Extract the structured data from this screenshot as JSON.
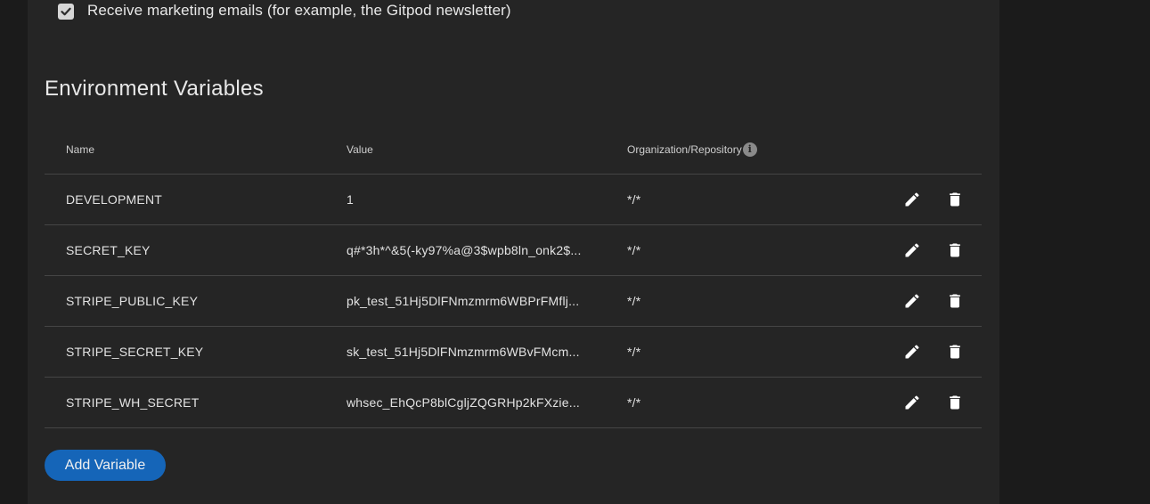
{
  "preferences": {
    "marketing_checkbox_checked": true,
    "marketing_label": "Receive marketing emails (for example, the Gitpod newsletter)"
  },
  "env_section": {
    "title": "Environment Variables",
    "columns": {
      "name": "Name",
      "value": "Value",
      "scope": "Organization/Repository"
    },
    "info_icon": "info-icon",
    "rows": [
      {
        "name": "DEVELOPMENT",
        "value": "1",
        "scope": "*/*"
      },
      {
        "name": "SECRET_KEY",
        "value": "q#*3h*^&5(-ky97%a@3$wpb8ln_onk2$...",
        "scope": "*/*"
      },
      {
        "name": "STRIPE_PUBLIC_KEY",
        "value": "pk_test_51Hj5DlFNmzmrm6WBPrFMflj...",
        "scope": "*/*"
      },
      {
        "name": "STRIPE_SECRET_KEY",
        "value": "sk_test_51Hj5DlFNmzmrm6WBvFMcm...",
        "scope": "*/*"
      },
      {
        "name": "STRIPE_WH_SECRET",
        "value": "whsec_EhQcP8blCgljZQGRHp2kFXzie...",
        "scope": "*/*"
      }
    ],
    "row_actions": [
      "edit-icon",
      "delete-icon"
    ],
    "add_button_label": "Add Variable"
  },
  "colors": {
    "background": "#1b1b1b",
    "panel": "#252525",
    "primary_button": "#1565b8",
    "divider": "#454545"
  }
}
